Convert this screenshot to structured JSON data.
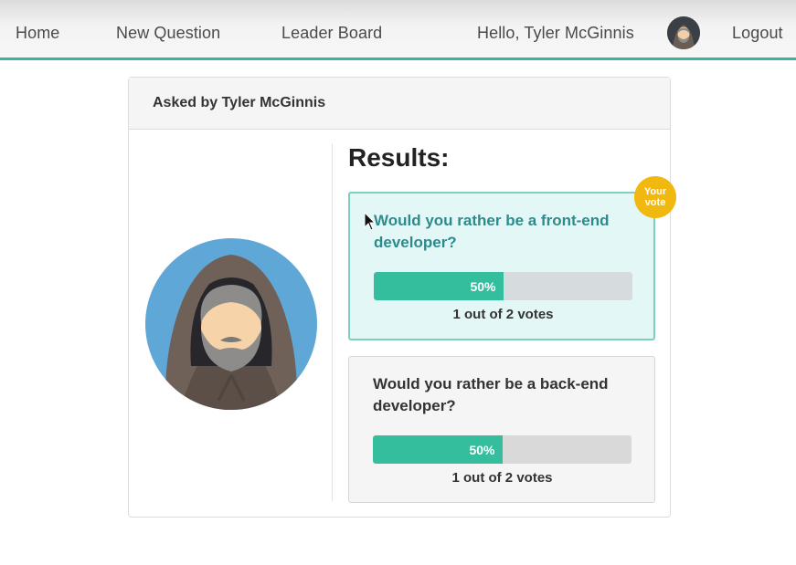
{
  "nav": {
    "home": "Home",
    "new_question": "New Question",
    "leader_board": "Leader Board",
    "greeting": "Hello, Tyler McGinnis",
    "logout": "Logout",
    "accent_color": "#38b59f"
  },
  "question": {
    "asked_by": "Asked by Tyler McGinnis",
    "results_title": "Results:",
    "your_vote_badge": "Your vote",
    "badge_color": "#f1b80f",
    "options": [
      {
        "text": "Would you rather be a front-end developer?",
        "percent_label": "50%",
        "percent": 50,
        "votes_text": "1 out of 2 votes",
        "voted": true
      },
      {
        "text": "Would you rather be a back-end developer?",
        "percent_label": "50%",
        "percent": 50,
        "votes_text": "1 out of 2 votes",
        "voted": false
      }
    ],
    "bar_color": "#35be9e"
  },
  "icons": {
    "user_avatar": "hooded-bearded-man-avatar",
    "cursor": "mouse-pointer-icon"
  }
}
